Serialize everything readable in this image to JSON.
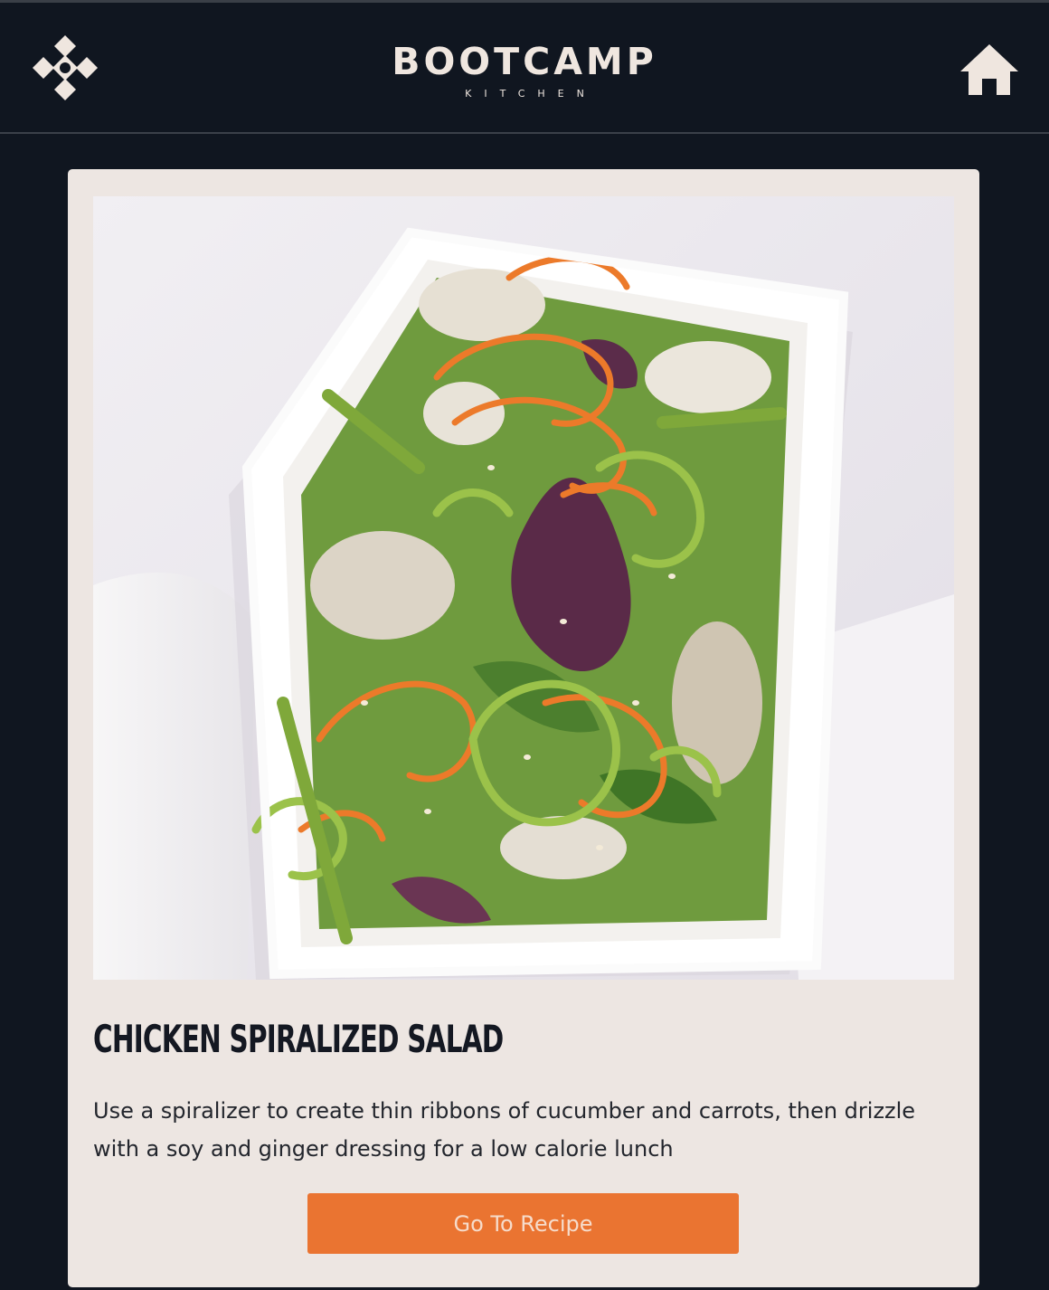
{
  "header": {
    "logo_main": "BOOTCAMP",
    "logo_sub": "KITCHEN",
    "menu_icon": "diamond-menu-icon",
    "home_icon": "home-icon"
  },
  "card": {
    "image_alt": "Chicken spiralized salad in a white container",
    "title": "CHICKEN SPIRALIZED SALAD",
    "description": "Use a spiralizer to create thin ribbons of cucumber and carrots, then drizzle with a soy and ginger dressing for a low calorie lunch",
    "button_label": "Go To Recipe"
  },
  "colors": {
    "background": "#101620",
    "card": "#ede6e2",
    "accent": "#ea7431",
    "text_dark": "#141822",
    "logo": "#efe6df"
  }
}
